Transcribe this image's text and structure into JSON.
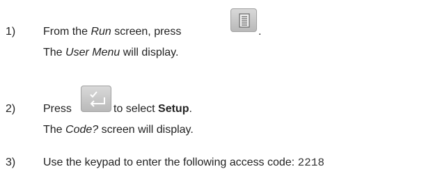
{
  "steps": [
    {
      "number": "1)",
      "line1_pre": "From the ",
      "line1_em": "Run",
      "line1_mid": " screen, press ",
      "line1_key_icon": "menu-list-key-icon",
      "line1_post": ".",
      "line2_pre": "The ",
      "line2_em": "User Menu",
      "line2_post": " will display."
    },
    {
      "number": "2)",
      "line1_pre": "Press ",
      "line1_key_icon": "check-enter-key-icon",
      "line1_mid": " to select ",
      "line1_strong": "Setup",
      "line1_post": ".",
      "line2_pre": "The ",
      "line2_em": "Code?",
      "line2_post": " screen will display."
    },
    {
      "number": "3)",
      "line1_pre": "Use the keypad to enter the following access code: ",
      "line1_code": "2218"
    }
  ]
}
